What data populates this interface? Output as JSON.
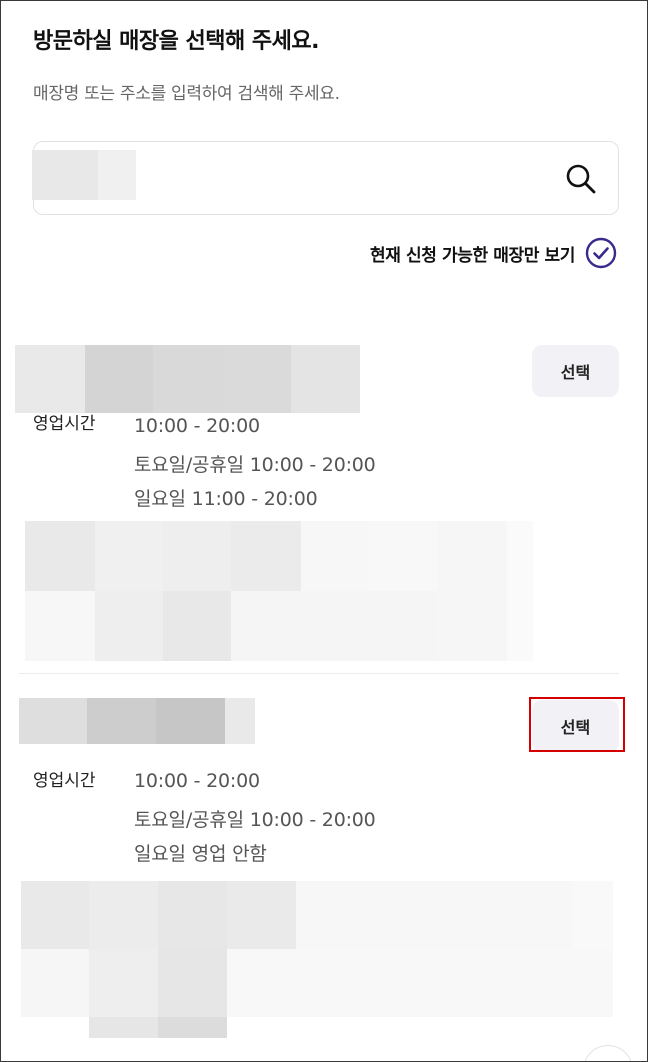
{
  "header": {
    "title": "방문하실 매장을 선택해 주세요.",
    "subtitle": "매장명 또는 주소를 입력하여 검색해 주세요."
  },
  "search": {
    "value": "",
    "placeholder": "",
    "icon": "search-icon"
  },
  "filter": {
    "label": "현재 신청 가능한 매장만 보기",
    "checked": true,
    "icon": "check-circle-icon",
    "accent": "#3b2a8c"
  },
  "stores": [
    {
      "select_label": "선택",
      "hours_label": "영업시간",
      "hours": [
        "10:00 - 20:00",
        "토요일/공휴일 10:00 - 20:00",
        "일요일 11:00 - 20:00"
      ]
    },
    {
      "select_label": "선택",
      "hours_label": "영업시간",
      "hours": [
        "10:00 - 20:00",
        "토요일/공휴일 10:00 - 20:00",
        "일요일 영업 안함"
      ],
      "highlighted": true
    }
  ],
  "colors": {
    "select_button_bg": "#f2f2f6",
    "highlight_border": "#d40000"
  }
}
